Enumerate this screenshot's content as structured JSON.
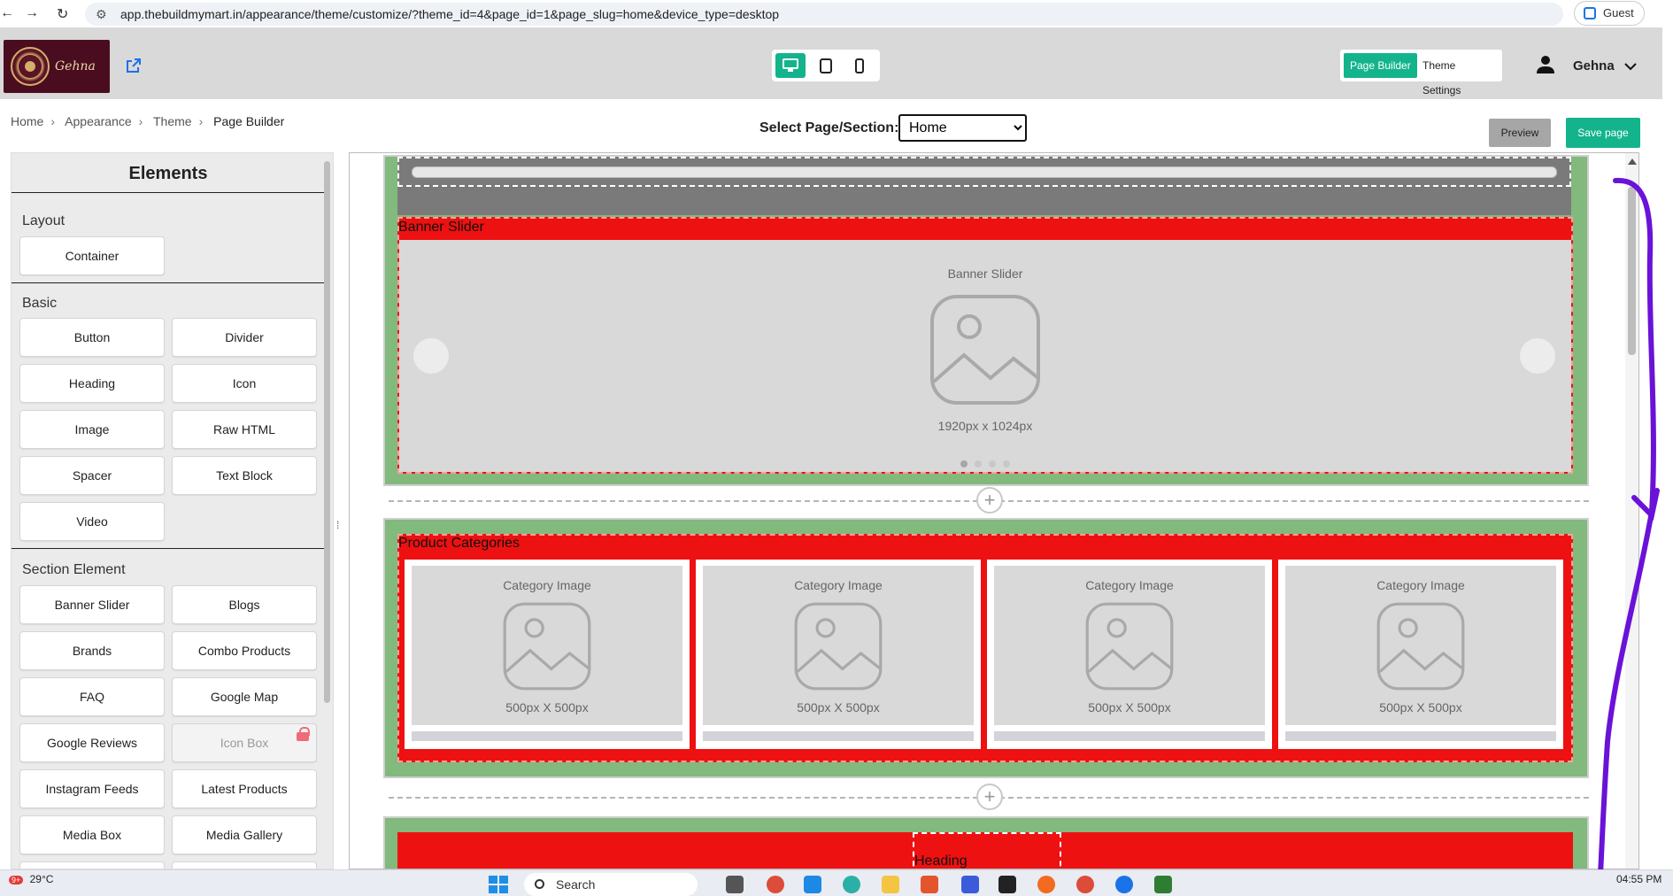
{
  "browser": {
    "url": "app.thebuildmymart.in/appearance/theme/customize/?theme_id=4&page_id=1&page_slug=home&device_type=desktop",
    "profile_label": "Guest"
  },
  "header": {
    "logo_text": "Gehna",
    "devices": [
      {
        "name": "desktop",
        "active": true
      },
      {
        "name": "tablet",
        "active": false
      },
      {
        "name": "mobile",
        "active": false
      }
    ],
    "modes": [
      "Page Builder",
      "Theme Settings"
    ],
    "active_mode": "Page Builder",
    "user_name": "Gehna"
  },
  "breadcrumb": [
    "Home",
    "Appearance",
    "Theme",
    "Page Builder"
  ],
  "page_select": {
    "label": "Select Page/Section:",
    "selected": "Home"
  },
  "actions": {
    "preview": "Preview",
    "save": "Save page"
  },
  "elements_panel": {
    "title": "Elements",
    "layout": {
      "label": "Layout",
      "items": [
        "Container"
      ]
    },
    "basic": {
      "label": "Basic",
      "items": [
        "Button",
        "Divider",
        "Heading",
        "Icon",
        "Image",
        "Raw HTML",
        "Spacer",
        "Text Block",
        "Video"
      ]
    },
    "section": {
      "label": "Section Element",
      "items": [
        "Banner Slider",
        "Blogs",
        "Brands",
        "Combo Products",
        "FAQ",
        "Google Map",
        "Google Reviews",
        "Icon Box",
        "Instagram Feeds",
        "Latest Products",
        "Media Box",
        "Media Gallery"
      ]
    },
    "locked_item": "Icon Box"
  },
  "canvas": {
    "banner": {
      "section_label": "Banner Slider",
      "placeholder_title": "Banner Slider",
      "placeholder_size": "1920px x 1024px",
      "slide_count": 4,
      "active_slide": 1
    },
    "categories": {
      "section_label": "Product Categories",
      "cards": [
        {
          "title": "Category Image",
          "size": "500px X 500px"
        },
        {
          "title": "Category Image",
          "size": "500px X 500px"
        },
        {
          "title": "Category Image",
          "size": "500px X 500px"
        },
        {
          "title": "Category Image",
          "size": "500px X 500px"
        }
      ]
    },
    "heading_section": {
      "label": "Heading"
    }
  },
  "taskbar": {
    "temperature": "29°C",
    "notification_badge": "9+",
    "search_placeholder": "Search",
    "time": "04:55 PM"
  },
  "colors": {
    "accent": "#13b48c",
    "section_red": "#ee1111",
    "container_green": "#82b97d",
    "annotation_purple": "#6a12d8"
  }
}
